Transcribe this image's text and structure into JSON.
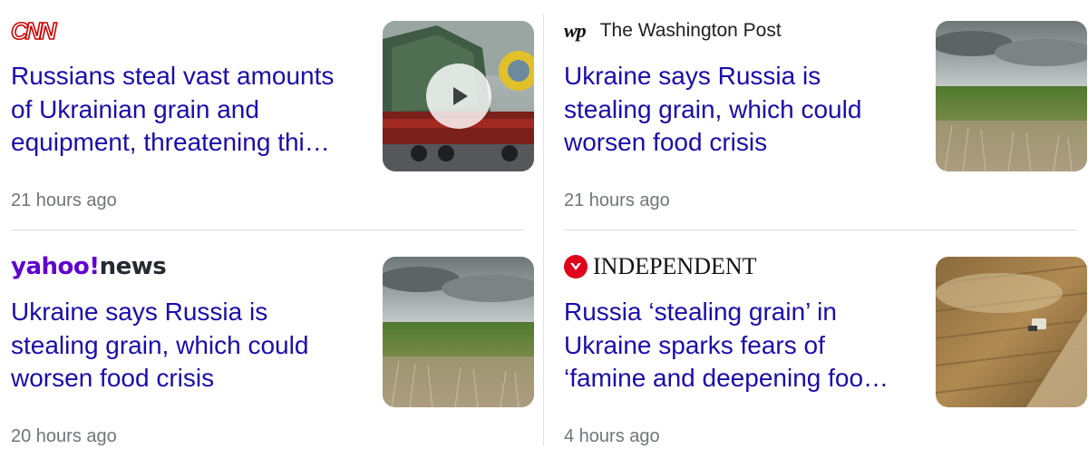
{
  "cards": [
    {
      "source_name": "CNN",
      "headline": "Russians steal vast amounts of Ukrainian grain and equipment, threatening thi…",
      "time": "21 hours ago",
      "thumb_icon": "play-icon"
    },
    {
      "source_mark": "wp",
      "source_name": "The Washington Post",
      "headline": "Ukraine says Russia is stealing grain, which could worsen food crisis",
      "time": "21 hours ago"
    },
    {
      "source_name_part1": "yahoo",
      "source_name_part2": "!",
      "source_name_part3": "news",
      "headline": "Ukraine says Russia is stealing grain, which could worsen food crisis",
      "time": "20 hours ago"
    },
    {
      "source_name": "INDEPENDENT",
      "headline": "Russia ‘stealing grain’ in Ukraine sparks fears of ‘famine and deepening foo…",
      "time": "4 hours ago"
    }
  ],
  "colors": {
    "headline": "#1a0dab",
    "timestamp": "#70757a",
    "cnn_red": "#cc0000",
    "yahoo_purple": "#6001d2",
    "independent_red": "#e0001b"
  }
}
